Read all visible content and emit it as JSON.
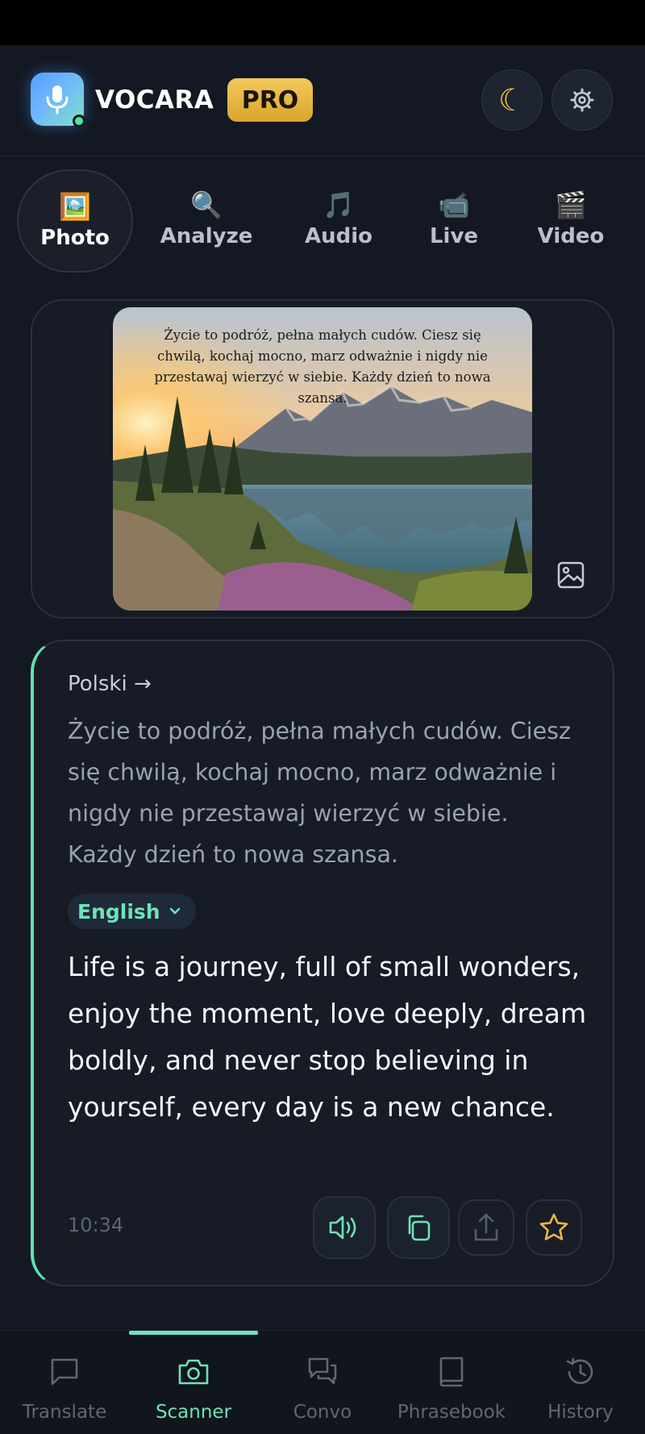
{
  "app": {
    "brand": "VOCARA",
    "badge": "PRO"
  },
  "header": {
    "theme_icon": "moon-icon",
    "settings_icon": "gear-icon"
  },
  "modes": [
    {
      "label": "Photo",
      "icon": "picture-icon",
      "glyph": "🖼️",
      "active": true
    },
    {
      "label": "Analyze",
      "icon": "magnifier-icon",
      "glyph": "🔍",
      "active": false
    },
    {
      "label": "Audio",
      "icon": "music-note-icon",
      "glyph": "🎵",
      "active": false
    },
    {
      "label": "Live",
      "icon": "video-camera-icon",
      "glyph": "📹",
      "active": false
    },
    {
      "label": "Video",
      "icon": "clapper-icon",
      "glyph": "🎬",
      "active": false
    }
  ],
  "photo": {
    "overlay_text": "Życie to podróż, pełna małych cudów. Ciesz się chwilą, kochaj mocno, marz odważnie i nigdy nie przestawaj wierzyć w siebie. Każdy dzień to nowa szansa."
  },
  "translation": {
    "source_lang": "Polski →",
    "source_text": "Życie to podróż, pełna małych cudów. Ciesz się chwilą, kochaj mocno, marz odważnie i nigdy nie przestawaj wierzyć w siebie. Każdy dzień to nowa szansa.",
    "target_lang": "English",
    "target_text": "Life is a journey, full of small wonders, enjoy the moment, love deeply, dream boldly, and never stop believing in yourself, every day is a new chance.",
    "time": "10:34",
    "actions": [
      "speaker-icon",
      "copy-icon",
      "share-icon",
      "star-icon"
    ]
  },
  "bottom_nav": [
    {
      "label": "Translate",
      "active": false
    },
    {
      "label": "Scanner",
      "active": true
    },
    {
      "label": "Convo",
      "active": false
    },
    {
      "label": "Phrasebook",
      "active": false
    },
    {
      "label": "History",
      "active": false
    }
  ],
  "colors": {
    "accent": "#6ee3b8",
    "badge": "#e8b844",
    "background": "#131822"
  }
}
